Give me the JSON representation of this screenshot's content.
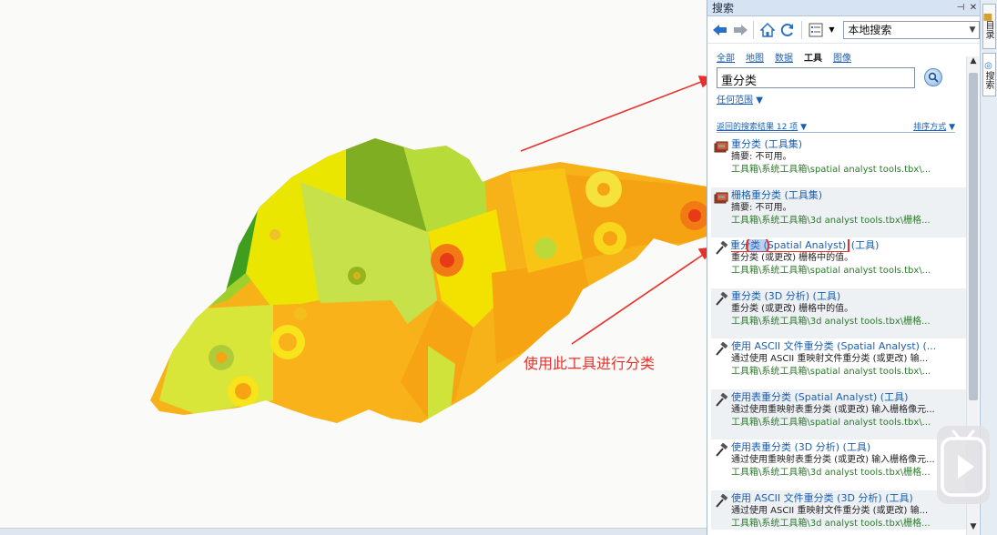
{
  "annotation": {
    "text": "使用此工具进行分类"
  },
  "search_pane": {
    "title": "搜索",
    "title_controls": [
      "⊕",
      "×"
    ],
    "toolbar": {
      "back_icon": "back-arrow-icon",
      "forward_icon": "forward-arrow-icon",
      "home_icon": "home-icon",
      "refresh_icon": "refresh-icon",
      "options_icon": "list-options-icon",
      "scope_value": "本地搜索"
    },
    "filters": [
      "全部",
      "地图",
      "数据",
      "工具",
      "图像"
    ],
    "active_filter": "工具",
    "search_value": "重分类",
    "search_icon": "magnifier-icon",
    "range_label": "任何范围",
    "results_label": "返回的搜索结果 12 项",
    "sort_label": "排序方式",
    "results": [
      {
        "title": "重分类",
        "type": "(工具集)",
        "icon": "toolset-icon",
        "summary": "摘要: 不可用。",
        "path": "工具箱\\系统工具箱\\spatial analyst tools.tbx\\..."
      },
      {
        "title": "栅格重分类",
        "type": "(工具集)",
        "icon": "toolset-icon",
        "summary": "摘要: 不可用。",
        "path": "工具箱\\系统工具箱\\3d analyst tools.tbx\\栅格..."
      },
      {
        "title": "重分类 (Spatial Analyst)",
        "type": "(工具)",
        "icon": "hammer-icon",
        "summary": "重分类 (或更改) 栅格中的值。",
        "path": "工具箱\\系统工具箱\\spatial analyst tools.tbx\\..."
      },
      {
        "title": "重分类 (3D 分析)",
        "type": "(工具)",
        "icon": "hammer-icon",
        "summary": "重分类 (或更改) 栅格中的值。",
        "path": "工具箱\\系统工具箱\\3d analyst tools.tbx\\栅格..."
      },
      {
        "title": "使用 ASCII 文件重分类 (Spatial Analyst)",
        "type": "(...",
        "icon": "hammer-icon",
        "summary": "通过使用 ASCII 重映射文件重分类 (或更改) 输...",
        "path": "工具箱\\系统工具箱\\spatial analyst tools.tbx\\..."
      },
      {
        "title": "使用表重分类 (Spatial Analyst)",
        "type": "(工具)",
        "icon": "hammer-icon",
        "summary": "通过使用重映射表重分类 (或更改) 输入栅格像元...",
        "path": "工具箱\\系统工具箱\\spatial analyst tools.tbx\\..."
      },
      {
        "title": "使用表重分类 (3D 分析)",
        "type": "(工具)",
        "icon": "hammer-icon",
        "summary": "通过使用重映射表重分类 (或更改) 输入栅格像元...",
        "path": "工具箱\\系统工具箱\\3d analyst tools.tbx\\栅格..."
      },
      {
        "title": "使用 ASCII 文件重分类 (3D 分析)",
        "type": "(工具)",
        "icon": "hammer-icon",
        "summary": "通过使用 ASCII 重映射文件重分类 (或更改) 输...",
        "path": "工具箱\\系统工具箱\\3d analyst tools.tbx\\栅格..."
      }
    ]
  },
  "side_tabs": [
    "目录",
    "搜索"
  ],
  "colors": {
    "annotation_red": "#e8312b",
    "link_blue": "#1a5fb4",
    "path_green": "#2b7a2b"
  }
}
